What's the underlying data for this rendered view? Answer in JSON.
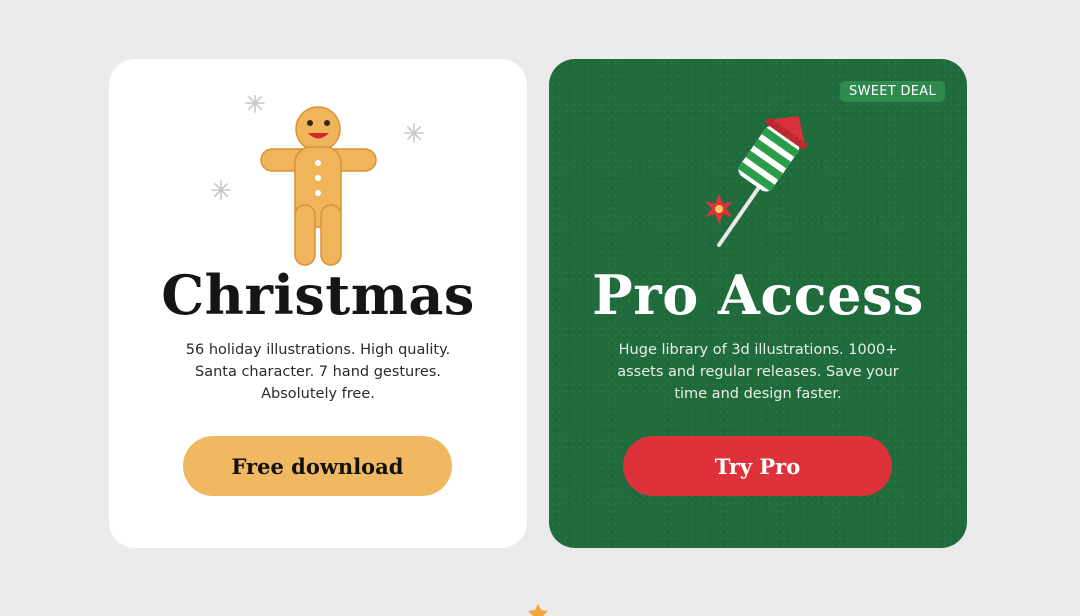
{
  "cards": {
    "free": {
      "title": "Christmas",
      "description": "56 holiday illustrations. High quality. Santa character. 7 hand gestures. Absolutely free.",
      "button_label": "Free download",
      "illustration_icon": "gingerbread-man-icon"
    },
    "pro": {
      "badge": "SWEET DEAL",
      "title": "Pro Access",
      "description": "Huge library of 3d illustrations. 1000+ assets and regular releases. Save your time and design faster.",
      "button_label": "Try Pro",
      "illustration_icon": "firework-rocket-icon"
    }
  },
  "colors": {
    "page_background": "#ebebeb",
    "free_card": "#ffffff",
    "pro_card": "#1f6b3b",
    "free_button": "#f0b860",
    "pro_button": "#dd3239",
    "badge": "#2f8a4e"
  }
}
